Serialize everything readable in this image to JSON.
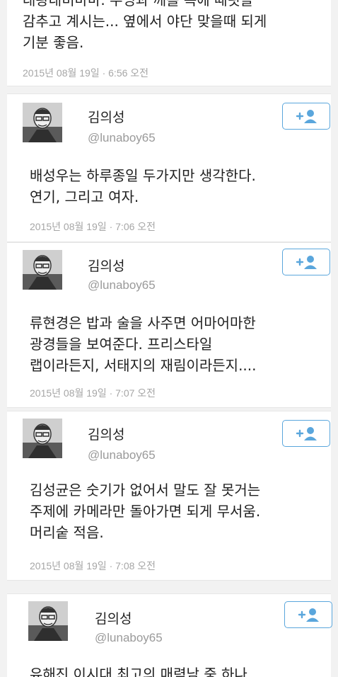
{
  "tweets": [
    {
      "text": "대왕대비마마. 우엉과 깨를 속에 때릿을\n감추고 계시는... 옆에서 야단 맞을때 되게\n기분 좋음.",
      "timestamp": "2015년 08월 19일 · 6:56 오전"
    },
    {
      "name": "김의성",
      "handle": "@lunaboy65",
      "text": "배성우는 하루종일 두가지만 생각한다.\n연기, 그리고 여자.",
      "timestamp": "2015년 08월 19일 · 7:06 오전"
    },
    {
      "name": "김의성",
      "handle": "@lunaboy65",
      "text": "류현경은 밥과 술을 사주면 어마어마한\n광경들을 보여준다. 프리스타일\n랩이라든지, 서태지의 재림이라든지....",
      "timestamp": "2015년 08월 19일 · 7:07 오전"
    },
    {
      "name": "김의성",
      "handle": "@lunaboy65",
      "text": "김성균은 숫기가 없어서 말도 잘 못거는\n주제에 카메라만 돌아가면 되게 무서움.\n머리숱 적음.",
      "timestamp": "2015년 08월 19일 · 7:08 오전"
    },
    {
      "name": "김의성",
      "handle": "@lunaboy65",
      "text": "유해진 이시대 최고의 매력남 중 하나"
    }
  ],
  "colors": {
    "follow_border": "#5aa6dc",
    "follow_icon": "#5aa6dc"
  },
  "icons": {
    "follow": "add-person-icon",
    "avatar": "avatar-illustration"
  }
}
